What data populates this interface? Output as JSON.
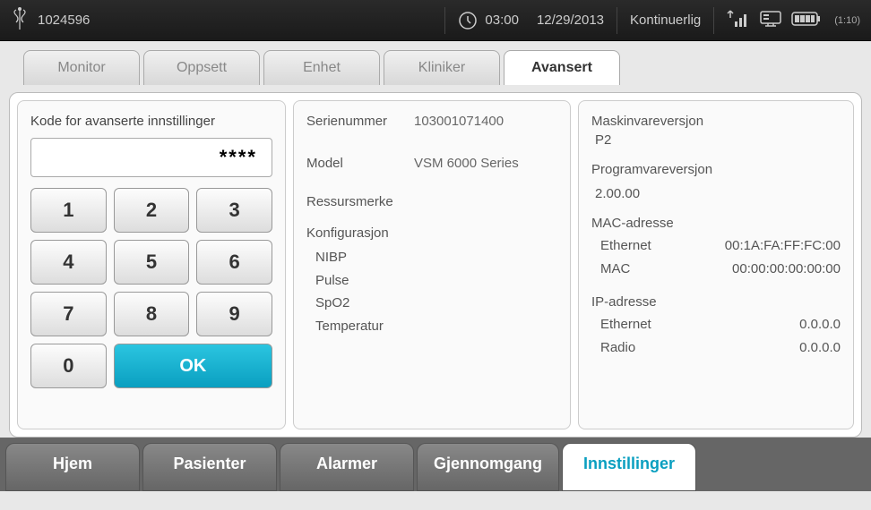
{
  "status": {
    "patient_id": "1024596",
    "time": "03:00",
    "date": "12/29/2013",
    "mode": "Kontinuerlig",
    "battery": "(1:10)"
  },
  "top_tabs": [
    {
      "label": "Monitor",
      "active": false
    },
    {
      "label": "Oppsett",
      "active": false
    },
    {
      "label": "Enhet",
      "active": false
    },
    {
      "label": "Kliniker",
      "active": false
    },
    {
      "label": "Avansert",
      "active": true
    }
  ],
  "keypad": {
    "title": "Kode for avanserte innstillinger",
    "display": "****",
    "keys": [
      "1",
      "2",
      "3",
      "4",
      "5",
      "6",
      "7",
      "8",
      "9",
      "0"
    ],
    "ok": "OK"
  },
  "device": {
    "serial_label": "Serienummer",
    "serial_value": "103001071400",
    "model_label": "Model",
    "model_value": "VSM 6000 Series",
    "asset_label": "Ressursmerke",
    "asset_value": "",
    "config_label": "Konfigurasjon",
    "config_items": [
      "NIBP",
      "Pulse",
      "SpO2",
      "Temperatur"
    ]
  },
  "system": {
    "hw_label": "Maskinvareversjon",
    "hw_value": "P2",
    "sw_label": "Programvareversjon",
    "sw_value": "2.00.00",
    "mac_label": "MAC-adresse",
    "mac_eth_label": "Ethernet",
    "mac_eth_value": "00:1A:FA:FF:FC:00",
    "mac_mac_label": "MAC",
    "mac_mac_value": "00:00:00:00:00:00",
    "ip_label": "IP-adresse",
    "ip_eth_label": "Ethernet",
    "ip_eth_value": "0.0.0.0",
    "ip_radio_label": "Radio",
    "ip_radio_value": "0.0.0.0"
  },
  "bottom_tabs": [
    {
      "label": "Hjem",
      "active": false
    },
    {
      "label": "Pasienter",
      "active": false
    },
    {
      "label": "Alarmer",
      "active": false
    },
    {
      "label": "Gjennomgang",
      "active": false
    },
    {
      "label": "Innstillinger",
      "active": true
    }
  ]
}
